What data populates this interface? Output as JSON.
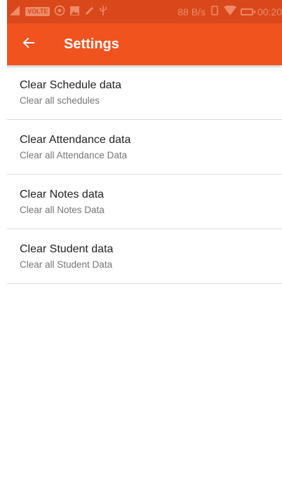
{
  "status_bar": {
    "network_badge": "VOLTE",
    "speed": "88 B/s",
    "time": "00:20",
    "icons": [
      "signal-icon",
      "whatsapp-icon",
      "image-icon",
      "edit-icon",
      "usb-icon",
      "vibrate-icon",
      "wifi-icon",
      "battery-icon"
    ],
    "color": "#d8481b"
  },
  "app_bar": {
    "title": "Settings",
    "back_icon": "arrow-back-icon",
    "color": "#f0531e"
  },
  "settings": {
    "items": [
      {
        "title": "Clear Schedule data",
        "subtitle": "Clear all schedules"
      },
      {
        "title": "Clear Attendance data",
        "subtitle": "Clear all Attendance Data"
      },
      {
        "title": "Clear Notes data",
        "subtitle": "Clear all Notes Data"
      },
      {
        "title": "Clear Student data",
        "subtitle": "Clear all Student Data"
      }
    ]
  }
}
